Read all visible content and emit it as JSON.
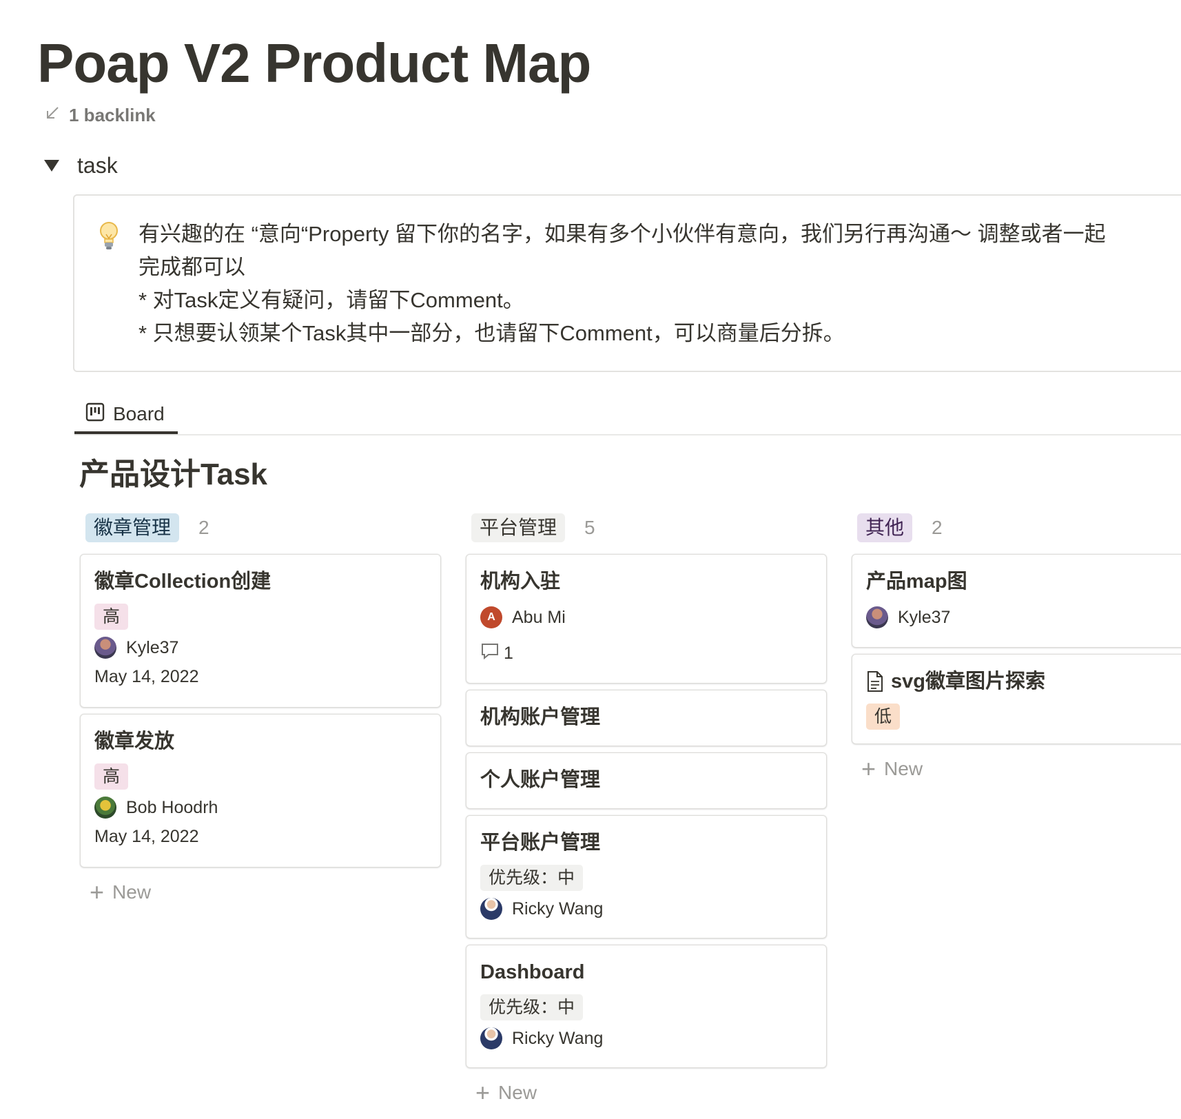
{
  "page": {
    "title": "Poap V2 Product Map",
    "backlink": "1 backlink",
    "toggle_label": "task"
  },
  "callout": {
    "icon": "lightbulb-icon",
    "lines": [
      "有兴趣的在 “意向“Property 留下你的名字，如果有多个小伙伴有意向，我们另行再沟通～ 调整或者一起",
      "完成都可以",
      "* 对Task定义有疑问，请留下Comment。",
      "* 只想要认领某个Task其中一部分，也请留下Comment，可以商量后分拆。"
    ]
  },
  "view": {
    "tab_label": "Board",
    "board_title": "产品设计Task"
  },
  "columns": [
    {
      "name": "徽章管理",
      "count": "2",
      "tag_bg": "#d3e5ef",
      "tag_fg": "#183347",
      "cards": [
        {
          "title": "徽章Collection创建",
          "priority": "高",
          "assignee": "Kyle37",
          "date": "May 14, 2022"
        },
        {
          "title": "徽章发放",
          "priority": "高",
          "assignee": "Bob Hoodrh",
          "date": "May 14, 2022"
        }
      ],
      "new_label": "New"
    },
    {
      "name": "平台管理",
      "count": "5",
      "tag_bg": "#f1f1ef",
      "tag_fg": "#37352f",
      "cards": [
        {
          "title": "机构入驻",
          "assignee": "Abu Mi",
          "comments": "1"
        },
        {
          "title": "机构账户管理"
        },
        {
          "title": "个人账户管理"
        },
        {
          "title": "平台账户管理",
          "priority": "优先级：中",
          "assignee": "Ricky Wang"
        },
        {
          "title": "Dashboard",
          "priority": "优先级：中",
          "assignee": "Ricky Wang"
        }
      ],
      "new_label": "New"
    },
    {
      "name": "其他",
      "count": "2",
      "tag_bg": "#e8deee",
      "tag_fg": "#412454",
      "cards": [
        {
          "title": "产品map图",
          "assignee": "Kyle37"
        },
        {
          "title": "svg徽章图片探索",
          "priority": "低"
        }
      ],
      "new_label": "New"
    }
  ],
  "colors": {
    "priority_high_bg": "#f5e0e9",
    "priority_mid_bg": "#f1f1ef",
    "priority_low_bg": "#fadec9",
    "text": "#37352f",
    "muted": "#9b9a97"
  }
}
